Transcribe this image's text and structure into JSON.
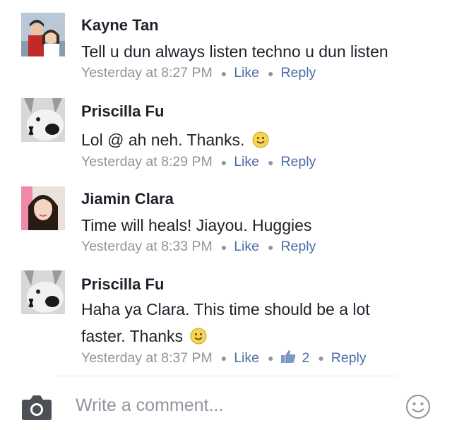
{
  "comments": [
    {
      "author": "Kayne Tan",
      "text_lines": [
        "Tell u dun always listen techno u dun listen"
      ],
      "timestamp": "Yesterday at 8:27 PM",
      "like_label": "Like",
      "reply_label": "Reply"
    },
    {
      "author": "Priscilla Fu",
      "text_lines": [
        "Lol @ ah neh. Thanks."
      ],
      "timestamp": "Yesterday at 8:29 PM",
      "like_label": "Like",
      "reply_label": "Reply",
      "emoji": "smile-emoji"
    },
    {
      "author": "Jiamin Clara",
      "text_lines": [
        "Time will heals! Jiayou.  Huggies"
      ],
      "timestamp": "Yesterday at 8:33 PM",
      "like_label": "Like",
      "reply_label": "Reply"
    },
    {
      "author": "Priscilla Fu",
      "text_lines": [
        "Haha ya Clara. This time should be a lot",
        "faster. Thanks"
      ],
      "timestamp": "Yesterday at 8:37 PM",
      "like_label": "Like",
      "like_count": "2",
      "reply_label": "Reply",
      "emoji": "smile-emoji"
    }
  ],
  "composer": {
    "placeholder": "Write a comment...",
    "camera_icon": "camera-icon",
    "emoji_icon": "emoji-picker-icon"
  },
  "colors": {
    "link": "#4b6aa7",
    "meta": "#90949c",
    "text": "#1d2129"
  }
}
